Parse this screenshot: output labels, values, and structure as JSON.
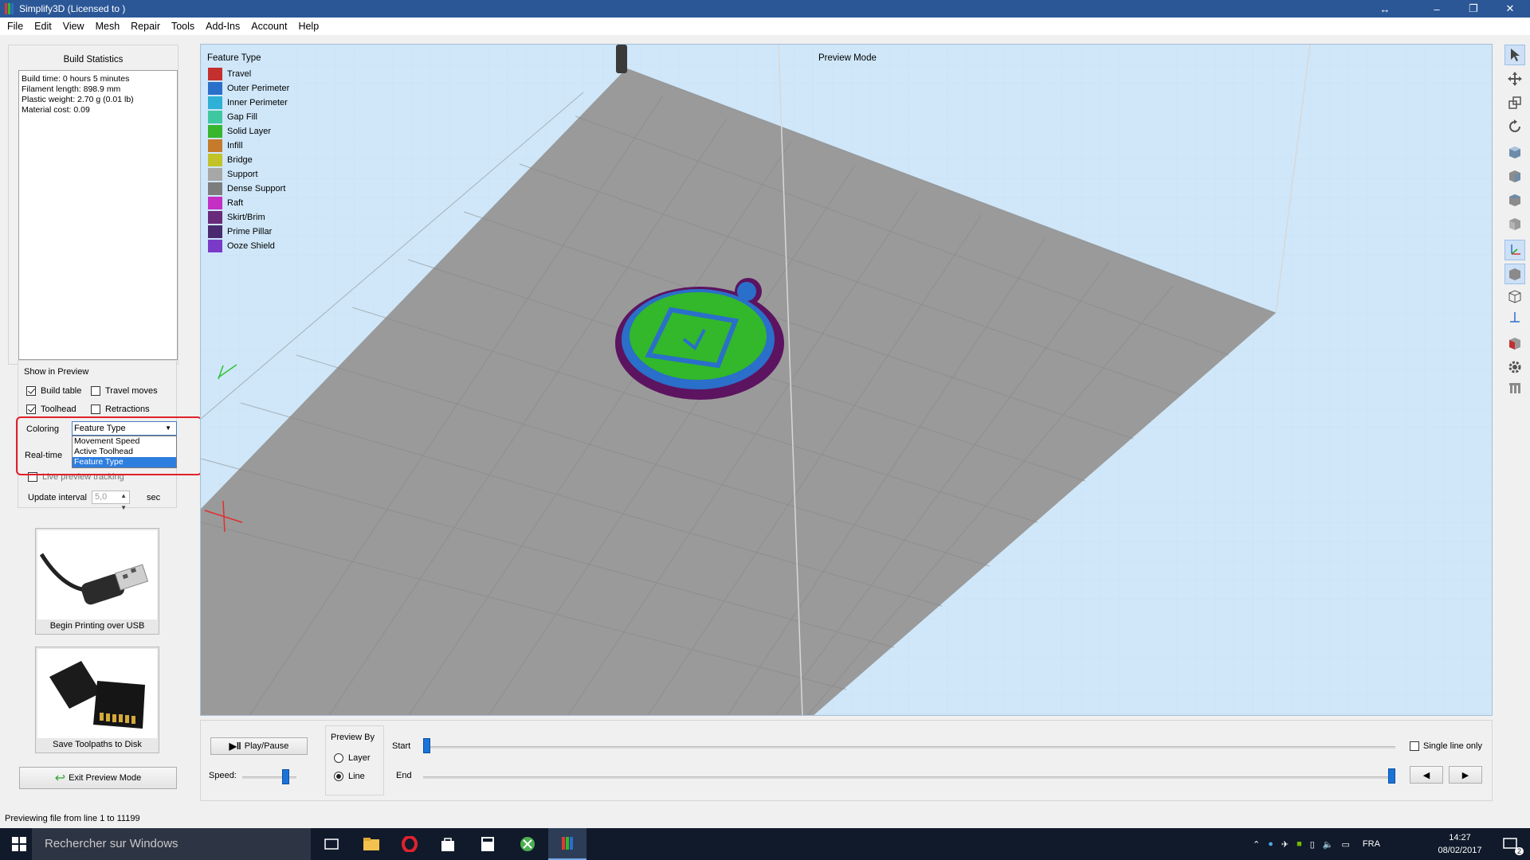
{
  "window": {
    "title": "Simplify3D (Licensed to )",
    "controls": {
      "resize": "↔",
      "minimize": "–",
      "restore": "❐",
      "close": "✕"
    }
  },
  "menu": [
    "File",
    "Edit",
    "View",
    "Mesh",
    "Repair",
    "Tools",
    "Add-Ins",
    "Account",
    "Help"
  ],
  "build_statistics": {
    "title": "Build Statistics",
    "lines": [
      "Build time: 0 hours 5 minutes",
      "Filament length: 898.9 mm",
      "Plastic weight: 2.70 g (0.01 lb)",
      "Material cost: 0.09"
    ]
  },
  "show_in_preview": {
    "title": "Show in Preview",
    "build_table": {
      "label": "Build table",
      "checked": true
    },
    "travel_moves": {
      "label": "Travel moves",
      "checked": false
    },
    "toolhead": {
      "label": "Toolhead",
      "checked": true
    },
    "retractions": {
      "label": "Retractions",
      "checked": false
    },
    "coloring_label": "Coloring",
    "coloring_value": "Feature Type",
    "coloring_options": [
      "Movement Speed",
      "Active Toolhead",
      "Feature Type"
    ],
    "realtime_label": "Real-time",
    "live_tracking": {
      "label": "Live preview tracking",
      "checked": false
    },
    "update_interval_label": "Update interval",
    "update_interval_value": "5,0",
    "update_interval_unit": "sec"
  },
  "actions": {
    "usb": "Begin Printing over USB",
    "disk": "Save Toolpaths to Disk",
    "exit": "Exit Preview Mode"
  },
  "viewport": {
    "legend_title": "Feature Type",
    "mode_label": "Preview Mode",
    "legend": [
      {
        "label": "Travel",
        "color": "#c4302e"
      },
      {
        "label": "Outer Perimeter",
        "color": "#2a6fc9"
      },
      {
        "label": "Inner Perimeter",
        "color": "#2fb0d6"
      },
      {
        "label": "Gap Fill",
        "color": "#3fc8a0"
      },
      {
        "label": "Solid Layer",
        "color": "#37b62e"
      },
      {
        "label": "Infill",
        "color": "#c67a2c"
      },
      {
        "label": "Bridge",
        "color": "#c2c22a"
      },
      {
        "label": "Support",
        "color": "#a7a7a7"
      },
      {
        "label": "Dense Support",
        "color": "#7d7d7d"
      },
      {
        "label": "Raft",
        "color": "#c42fc4"
      },
      {
        "label": "Skirt/Brim",
        "color": "#6a2a7a"
      },
      {
        "label": "Prime Pillar",
        "color": "#4a2a6e"
      },
      {
        "label": "Ooze Shield",
        "color": "#7a3ac8"
      }
    ]
  },
  "controls": {
    "play_pause": "Play/Pause",
    "speed_label": "Speed:",
    "speed_value": 0.85,
    "preview_by_title": "Preview By",
    "preview_by_layer": "Layer",
    "preview_by_line": "Line",
    "preview_by_selected": "Line",
    "start_label": "Start",
    "end_label": "End",
    "single_line_only": "Single line only",
    "start_value": 0,
    "end_value": 1,
    "prev": "◀",
    "next": "▶"
  },
  "status": "Previewing file from line 1 to 11199",
  "taskbar": {
    "search_placeholder": "Rechercher sur Windows",
    "lang": "FRA",
    "time": "14:27",
    "date": "08/02/2017",
    "notifications": "2"
  }
}
